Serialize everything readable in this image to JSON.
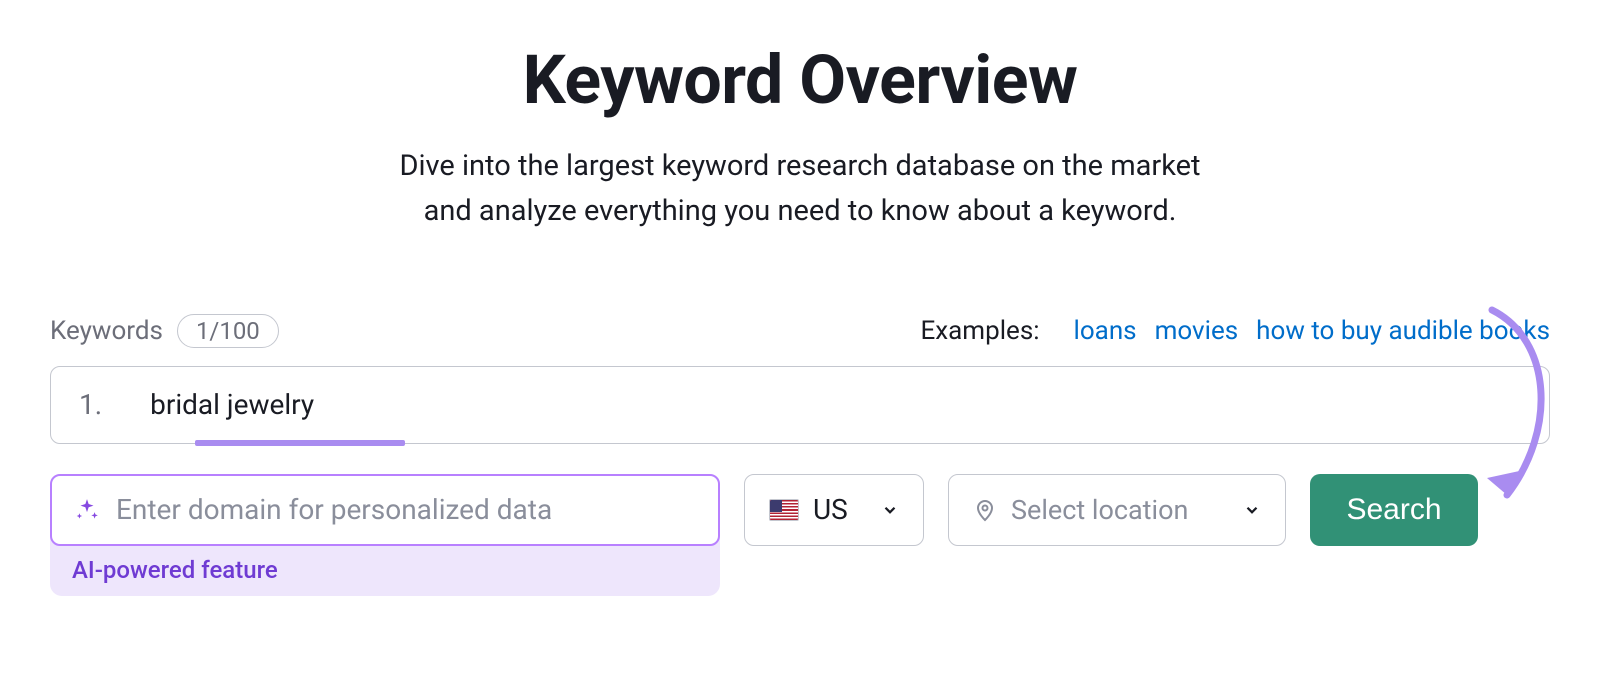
{
  "title": "Keyword Overview",
  "subtitle_line1": "Dive into the largest keyword research database on the market",
  "subtitle_line2": "and analyze everything you need to know about a keyword.",
  "keywords_label": "Keywords",
  "keywords_count": "1/100",
  "examples_label": "Examples:",
  "examples": [
    "loans",
    "movies",
    "how to buy audible books"
  ],
  "keyword_input": {
    "number": "1.",
    "value": "bridal jewelry"
  },
  "domain_input": {
    "placeholder": "Enter domain for personalized data",
    "ai_label": "AI-powered feature"
  },
  "country": {
    "code": "US",
    "flag": "us"
  },
  "location": {
    "placeholder": "Select location"
  },
  "search_label": "Search",
  "colors": {
    "accent_purple": "#a98cf0",
    "link_blue": "#006dca",
    "button_green": "#319176"
  }
}
